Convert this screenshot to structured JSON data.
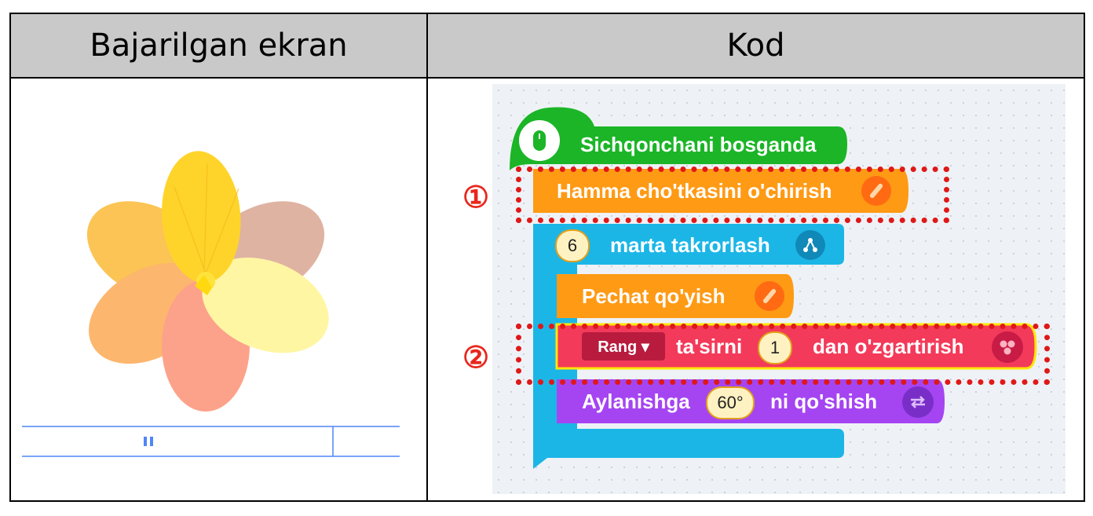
{
  "table": {
    "col_left_header": "Bajarilgan ekran",
    "col_right_header": "Kod"
  },
  "annotations": {
    "marker_1": "①",
    "marker_2": "②"
  },
  "player": {
    "pause_icon": "pause-icon"
  },
  "code_blocks": {
    "event": {
      "label": "Sichqonchani bosganda",
      "color": "#1bb527",
      "icon": "mouse-icon"
    },
    "clear": {
      "label": "Hamma cho'tkasini o'chirish",
      "color": "#ff9a15",
      "icon": "brush-icon"
    },
    "repeat": {
      "count": "6",
      "label": "marta takrorlash",
      "color": "#1cb6e6",
      "icon": "flow-icon"
    },
    "stamp": {
      "label": "Pechat qo'yish",
      "color": "#ff9a15",
      "icon": "brush-icon"
    },
    "effect": {
      "dropdown": "Rang ▾",
      "label_a": "ta'sirni",
      "value": "1",
      "label_b": "dan o'zgartirish",
      "color": "#f33a5a",
      "icon": "effect-icon"
    },
    "rotate": {
      "label_a": "Aylanishga",
      "value": "60°",
      "label_b": "ni qo'shish",
      "color": "#a545f2",
      "icon": "rotate-icon"
    }
  }
}
